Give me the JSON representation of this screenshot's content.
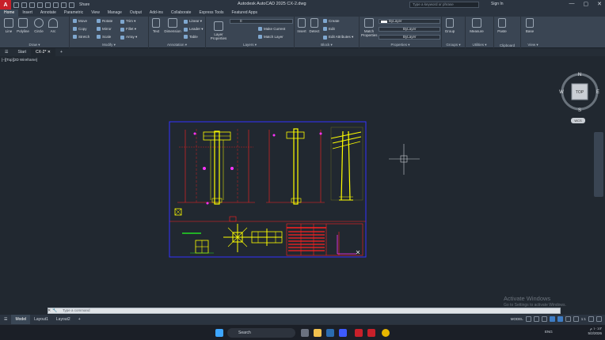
{
  "titlebar": {
    "app_letter": "A",
    "share": "Share",
    "title": "Autodesk AutoCAD 2025   CX-2.dwg",
    "search_placeholder": "Type a keyword or phrase",
    "signin": "Sign In",
    "minimize": "—",
    "maximize": "▢",
    "close": "✕"
  },
  "ribbon_tabs": [
    "Home",
    "Insert",
    "Annotate",
    "Parametric",
    "View",
    "Manage",
    "Output",
    "Add-ins",
    "Collaborate",
    "Express Tools",
    "Featured Apps"
  ],
  "ribbon": {
    "draw": {
      "title": "Draw ▾",
      "line": "Line",
      "polyline": "Polyline",
      "circle": "Circle",
      "arc": "Arc"
    },
    "modify": {
      "title": "Modify ▾",
      "move": "Move",
      "rotate": "Rotate",
      "trim": "Trim ▾",
      "copy": "Copy",
      "mirror": "Mirror",
      "fillet": "Fillet ▾",
      "stretch": "Stretch",
      "scale": "Scale",
      "array": "Array ▾"
    },
    "annotation": {
      "title": "Annotation ▾",
      "text": "Text",
      "dimension": "Dimension",
      "linear": "Linear ▾",
      "leader": "Leader ▾",
      "table": "Table"
    },
    "layers": {
      "title": "Layers ▾",
      "layer_properties": "Layer Properties",
      "layer_value": "0",
      "make_current": "Make Current",
      "match_layer": "Match Layer"
    },
    "block": {
      "title": "Block ▾",
      "insert": "Insert",
      "detect": "Detect",
      "create": "Create",
      "edit": "Edit",
      "edit_attributes": "Edit Attributes ▾"
    },
    "properties": {
      "title": "Properties ▾",
      "match": "Match Properties",
      "color": "ByLayer",
      "linetype": "ByLayer",
      "lineweight": "ByLayer"
    },
    "groups": {
      "title": "Groups ▾",
      "group": "Group"
    },
    "utilities": {
      "title": "Utilities ▾",
      "measure": "Measure"
    },
    "clipboard": {
      "title": "Clipboard",
      "paste": "Paste"
    },
    "view": {
      "title": "View ▾",
      "base": "Base"
    }
  },
  "file_tabs": {
    "menu": "☰",
    "start": "Start",
    "active": "CX-2*",
    "close": "✕",
    "add": "+"
  },
  "viewport": {
    "label": "[–][Top][2D Wireframe]",
    "viewcube": {
      "top": "TOP",
      "n": "N",
      "s": "S",
      "e": "E",
      "w": "W",
      "wcs": "WCS"
    }
  },
  "watermark": {
    "line1": "Activate Windows",
    "line2": "Go to Settings to activate Windows."
  },
  "command": {
    "placeholder": "Type a command"
  },
  "layout_tabs": [
    "Model",
    "Layout1",
    "Layout2"
  ],
  "status": {
    "model": "MODEL",
    "scale": "1:1"
  },
  "taskbar": {
    "search": "Search",
    "lang": "ENG",
    "time": "١٠:٤٢ م",
    "date": "5/2/2026"
  },
  "colors": {
    "accent": "#3e7cc4",
    "canvas": "#212830",
    "ribbon": "#3a4553",
    "drawing_blue": "#3232ff",
    "drawing_yellow": "#ffff00",
    "drawing_red": "#ff2020",
    "drawing_green": "#22dd22",
    "drawing_magenta": "#ff33ff"
  }
}
